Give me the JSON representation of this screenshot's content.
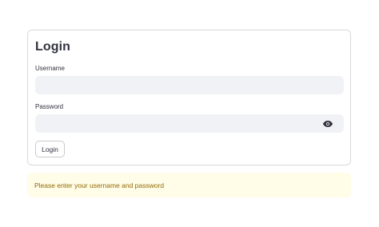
{
  "login_form": {
    "title": "Login",
    "username": {
      "label": "Username",
      "value": "",
      "placeholder": ""
    },
    "password": {
      "label": "Password",
      "value": "",
      "placeholder": ""
    },
    "show_password_icon": "eye-icon",
    "submit_label": "Login"
  },
  "alert": {
    "message": "Please enter your username and password",
    "type": "warning",
    "background_color": "#fffce7",
    "text_color": "#926c05"
  },
  "colors": {
    "input_background": "#f0f2f6",
    "card_border": "#d9d9dd",
    "text": "#31333f"
  }
}
